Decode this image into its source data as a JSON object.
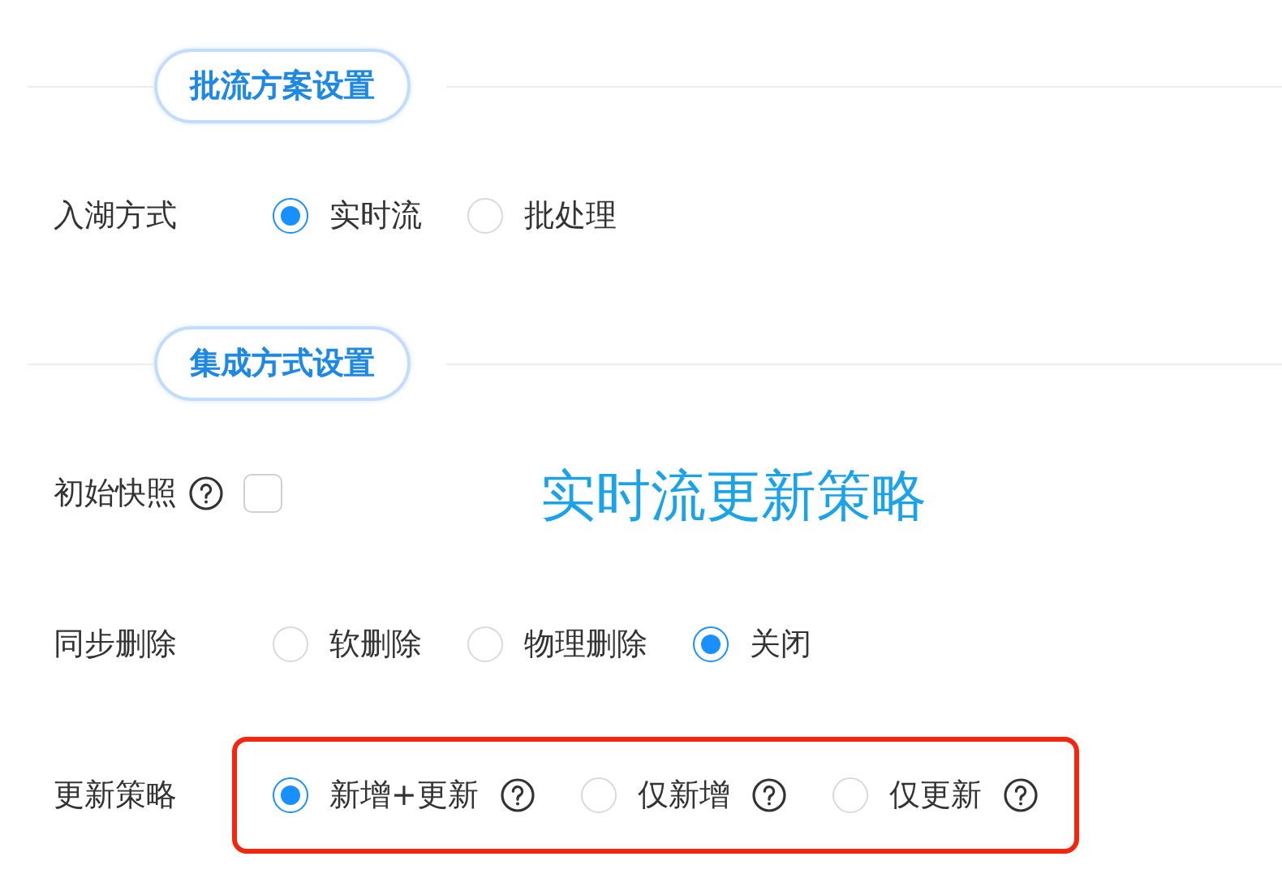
{
  "sections": [
    {
      "title": "批流方案设置",
      "rows": [
        {
          "label": "入湖方式",
          "kind": "radio",
          "highlighted": false,
          "options": [
            {
              "label": "实时流",
              "selected": true,
              "help": false
            },
            {
              "label": "批处理",
              "selected": false,
              "help": false
            }
          ]
        }
      ]
    },
    {
      "title": "集成方式设置",
      "rows": [
        {
          "label": "初始快照",
          "kind": "checkbox",
          "help": true,
          "checked": false,
          "highlighted": false,
          "annotation": "实时流更新策略"
        },
        {
          "label": "同步删除",
          "kind": "radio",
          "highlighted": false,
          "options": [
            {
              "label": "软删除",
              "selected": false,
              "help": false
            },
            {
              "label": "物理删除",
              "selected": false,
              "help": false
            },
            {
              "label": "关闭",
              "selected": true,
              "help": false
            }
          ]
        },
        {
          "label": "更新策略",
          "kind": "radio",
          "highlighted": true,
          "options": [
            {
              "label": "新增+更新",
              "selected": true,
              "help": true
            },
            {
              "label": "仅新增",
              "selected": false,
              "help": true
            },
            {
              "label": "仅更新",
              "selected": false,
              "help": true
            }
          ]
        }
      ]
    }
  ]
}
